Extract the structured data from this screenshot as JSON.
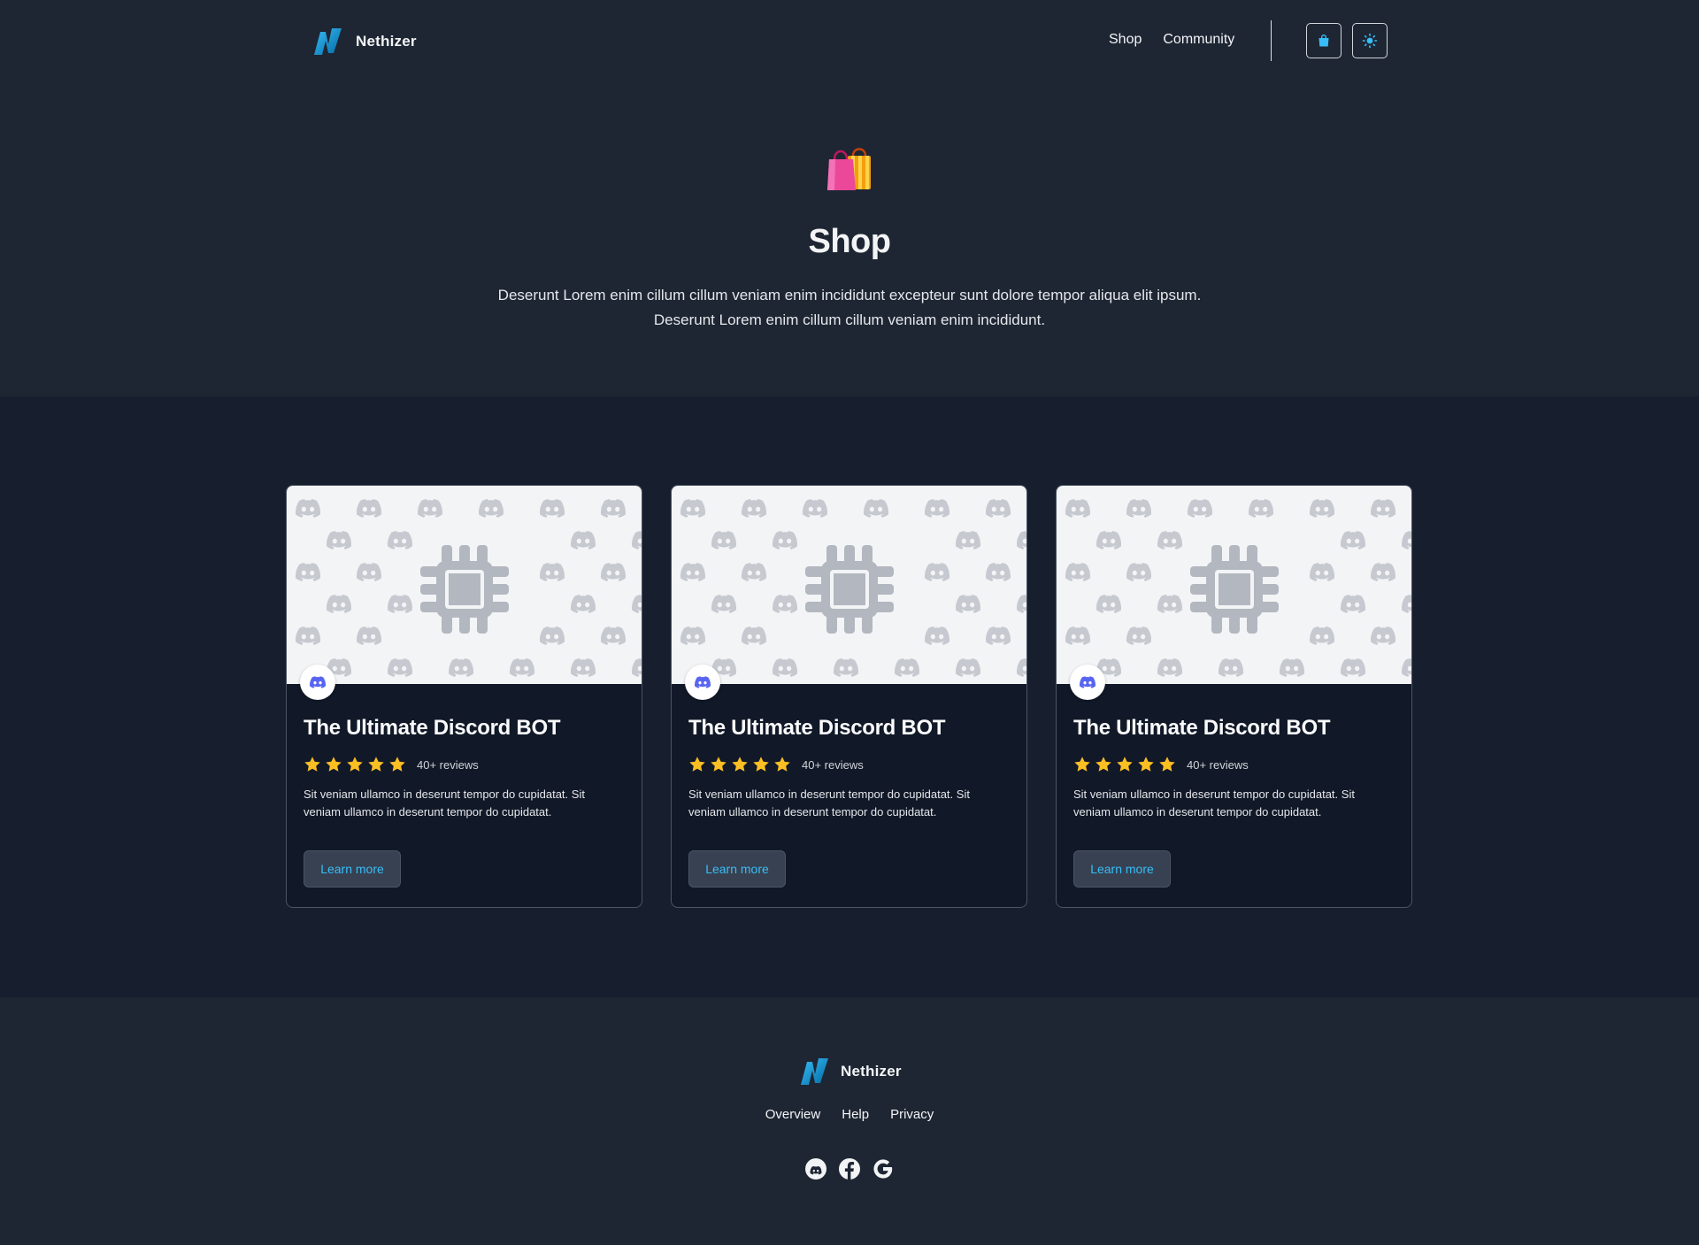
{
  "brand": {
    "name": "Nethizer"
  },
  "nav": {
    "items": [
      {
        "label": "Shop"
      },
      {
        "label": "Community"
      }
    ]
  },
  "header": {
    "cart_icon": "shopping-bag-icon",
    "theme_icon": "sun-icon"
  },
  "hero": {
    "icon": "shopping-bags-emoji",
    "title": "Shop",
    "subtitle_line1": "Deserunt Lorem enim cillum cillum veniam enim incididunt excepteur sunt dolore tempor aliqua elit ipsum.",
    "subtitle_line2": "Deserunt Lorem enim cillum cillum veniam enim incididunt."
  },
  "products": [
    {
      "title": "The Ultimate Discord BOT",
      "rating": 5,
      "reviews": "40+ reviews",
      "description": "Sit veniam ullamco in deserunt tempor do cupidatat. Sit veniam ullamco in deserunt tempor do cupidatat.",
      "button_label": "Learn more"
    },
    {
      "title": "The Ultimate Discord BOT",
      "rating": 5,
      "reviews": "40+ reviews",
      "description": "Sit veniam ullamco in deserunt tempor do cupidatat. Sit veniam ullamco in deserunt tempor do cupidatat.",
      "button_label": "Learn more"
    },
    {
      "title": "The Ultimate Discord BOT",
      "rating": 5,
      "reviews": "40+ reviews",
      "description": "Sit veniam ullamco in deserunt tempor do cupidatat. Sit veniam ullamco in deserunt tempor do cupidatat.",
      "button_label": "Learn more"
    }
  ],
  "footer": {
    "brand": "Nethizer",
    "links": [
      {
        "label": "Overview"
      },
      {
        "label": "Help"
      },
      {
        "label": "Privacy"
      }
    ],
    "socials": [
      "discord-icon",
      "facebook-icon",
      "google-icon"
    ]
  },
  "colors": {
    "page_bg": "#1e2633",
    "section_bg": "#171f2e",
    "card_bg": "#111827",
    "accent": "#38bdf8",
    "star": "#fbbf24",
    "logo_blue": "#0ea5e9"
  }
}
